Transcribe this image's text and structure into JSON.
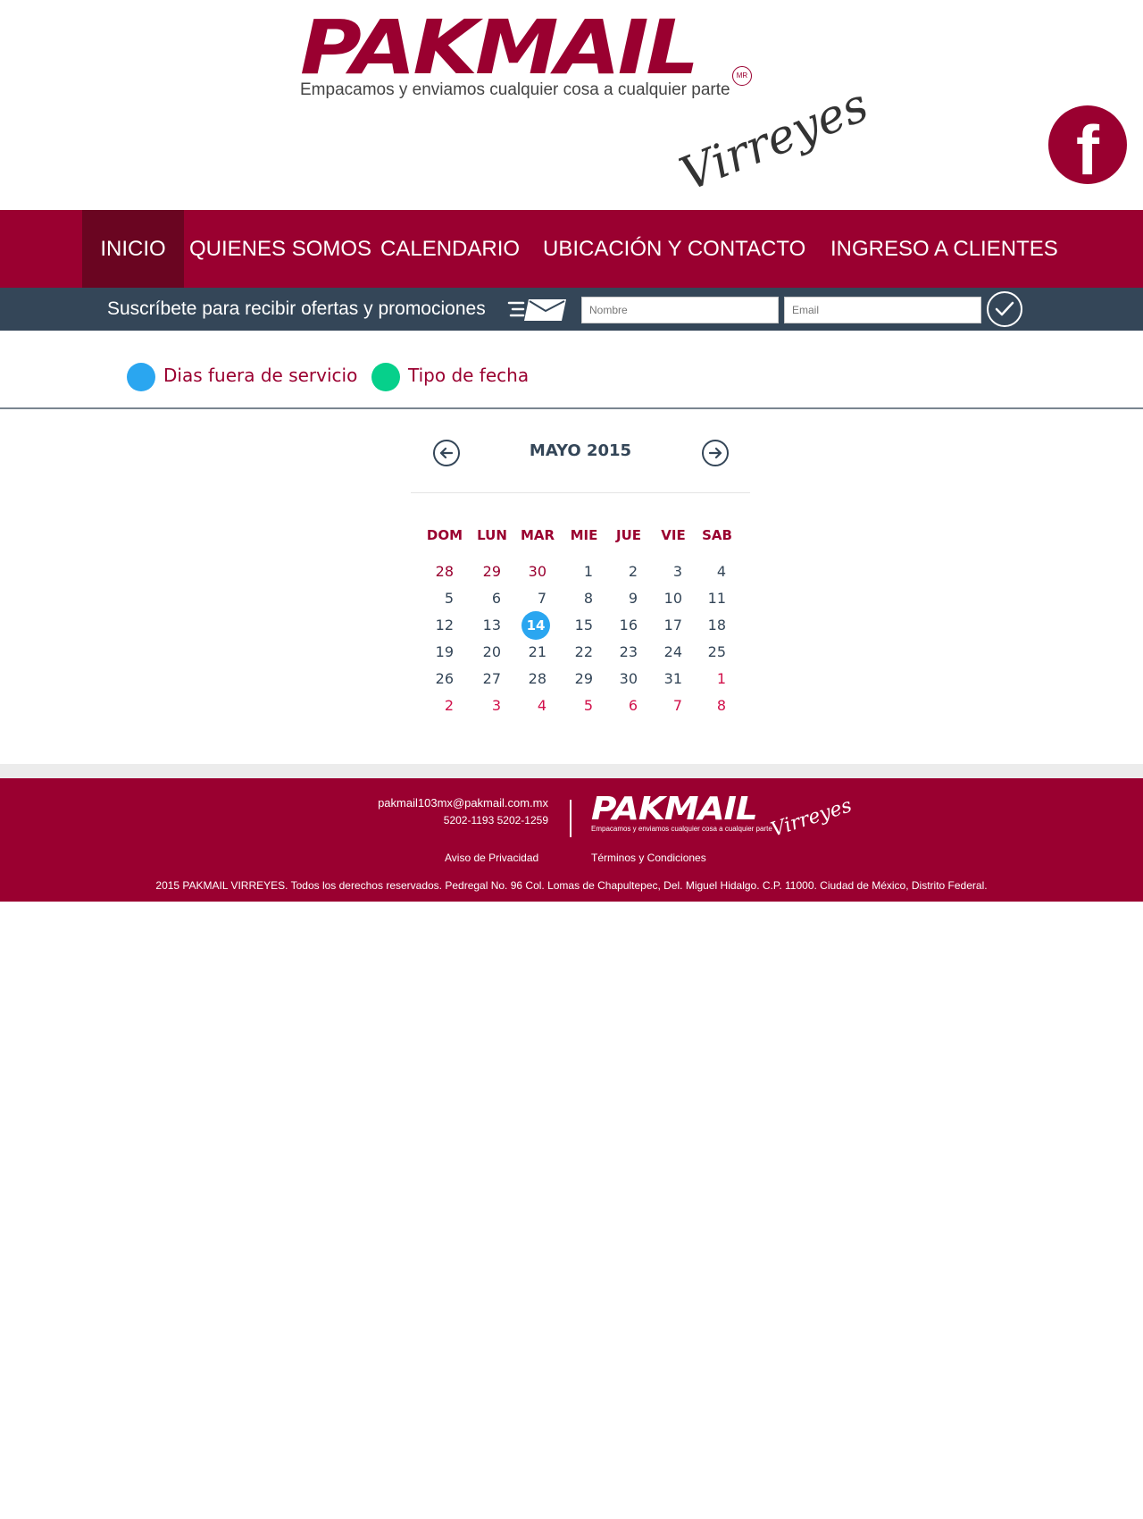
{
  "header": {
    "brand": "PAKMAIL",
    "brand_mark": "MR",
    "tagline": "Empacamos y enviamos cualquier cosa a cualquier parte",
    "branch": "Virreyes",
    "social_icon": "facebook-icon"
  },
  "nav": {
    "items": [
      {
        "label": "INICIO",
        "active": true
      },
      {
        "label": "QUIENES SOMOS"
      },
      {
        "label": "CALENDARIO"
      },
      {
        "label": "UBICACIÓN Y CONTACTO"
      },
      {
        "label": "INGRESO A CLIENTES"
      }
    ],
    "colors": {
      "bar": "#9a0030",
      "active": "#6a0521"
    }
  },
  "subscribe": {
    "text": "Suscríbete para recibir ofertas y promociones",
    "name_placeholder": "Nombre",
    "email_placeholder": "Email",
    "icons": [
      "envelope-icon",
      "check-icon"
    ]
  },
  "legend": {
    "items": [
      {
        "label": "Dias fuera de servicio",
        "color": "#2aa6f0"
      },
      {
        "label": "Tipo de fecha",
        "color": "#06d08b"
      }
    ]
  },
  "calendar": {
    "title": "MAYO 2015",
    "weekdays": [
      "DOM",
      "LUN",
      "MAR",
      "MIE",
      "JUE",
      "VIE",
      "SAB"
    ],
    "weeks": [
      [
        "28",
        "29",
        "30",
        "1",
        "2",
        "3",
        "4"
      ],
      [
        "5",
        "6",
        "7",
        "8",
        "9",
        "10",
        "11"
      ],
      [
        "12",
        "13",
        "14",
        "15",
        "16",
        "17",
        "18"
      ],
      [
        "19",
        "20",
        "21",
        "22",
        "23",
        "24",
        "25"
      ],
      [
        "26",
        "27",
        "28",
        "29",
        "30",
        "31",
        "1"
      ],
      [
        "2",
        "3",
        "4",
        "5",
        "6",
        "7",
        "8"
      ]
    ],
    "selected": "14",
    "icons": [
      "arrow-left-icon",
      "arrow-right-icon"
    ]
  },
  "footer": {
    "email": "pakmail103mx@pakmail.com.mx",
    "phones": "5202-1193   5202-1259",
    "brand": "PAKMAIL",
    "tagline": "Empacamos y enviamos cualquier cosa a cualquier parte",
    "branch": "Virreyes",
    "privacy": "Aviso de Privacidad",
    "terms": "Términos y Condiciones",
    "copyright": "2015 PAKMAIL VIRREYES. Todos los derechos reservados. Pedregal No. 96 Col. Lomas de Chapultepec, Del. Miguel Hidalgo. C.P. 11000. Ciudad de México, Distrito Federal."
  }
}
